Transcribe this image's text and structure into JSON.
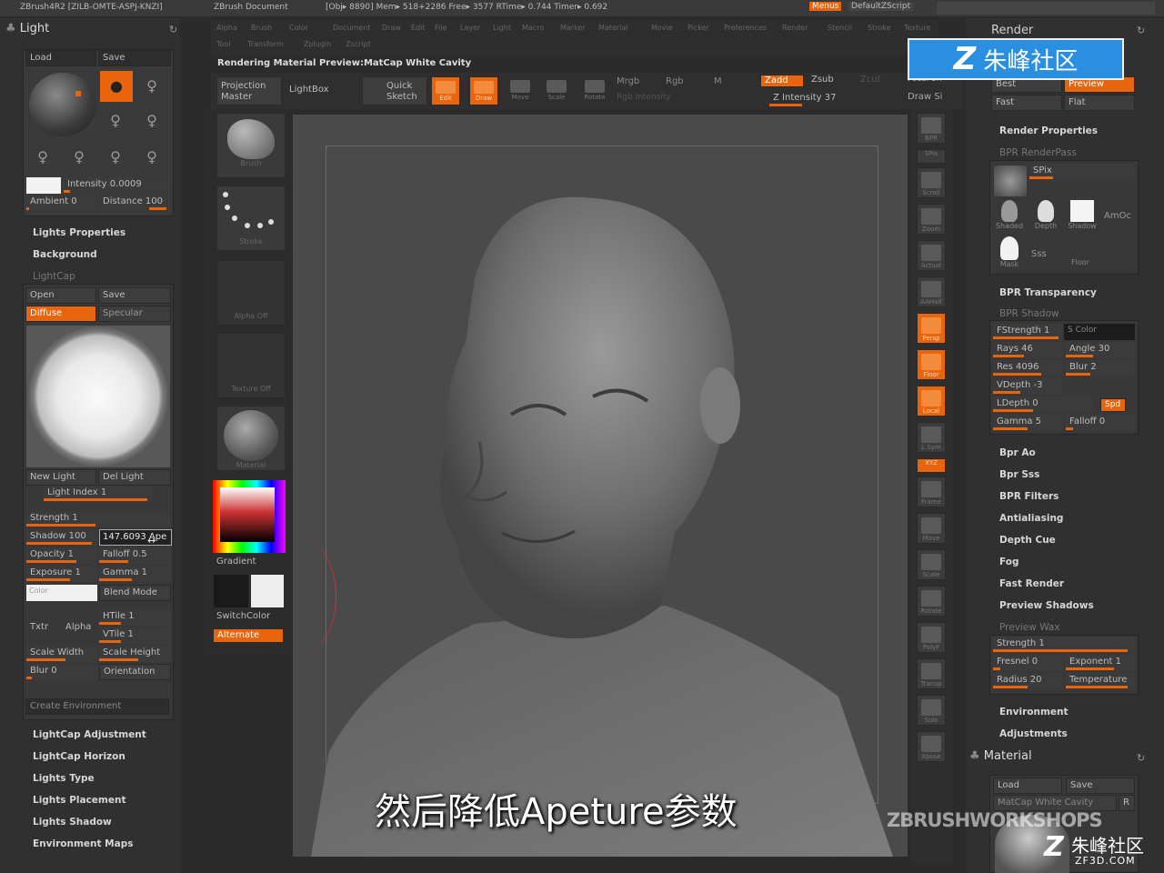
{
  "titlebar": {
    "app": "ZBrush4R2 [ZILB-OMTE-ASPJ-KNZI]",
    "doc": "ZBrush Document",
    "stats": "[Obj▸ 8890] Mem▸ 518+2286 Free▸ 3577 RTime▸ 0.744 Timer▸ 0.692",
    "menus_btn": "Menus",
    "script_btn": "DefaultZScript"
  },
  "menubar": {
    "row1": [
      "Alpha",
      "Brush",
      "Color",
      "Document",
      "Draw",
      "Edit",
      "File",
      "Layer",
      "Light",
      "Macro",
      "Marker",
      "Material",
      "Movie",
      "Picker",
      "Preferences",
      "Render",
      "Stencil",
      "Stroke",
      "Texture"
    ],
    "row2": [
      "Tool",
      "Transform",
      "Zplugin",
      "Zscript"
    ]
  },
  "status_text": "Rendering Material Preview:MatCap White Cavity",
  "light_panel": {
    "title": "Light",
    "load": "Load",
    "save": "Save",
    "intensity": "Intensity 0.0009",
    "ambient": "Ambient 0",
    "distance": "Distance 100",
    "lights_properties": "Lights Properties",
    "background": "Background",
    "lightcap": "LightCap",
    "open": "Open",
    "save2": "Save",
    "diffuse": "Diffuse",
    "specular": "Specular",
    "new_light": "New Light",
    "del_light": "Del Light",
    "light_index": "Light Index 1",
    "strength": "Strength 1",
    "shadow": "Shadow 100",
    "aperture_value": "147.6093",
    "aperture_suffix": "Ape",
    "opacity": "Opacity 1",
    "falloff": "Falloff 0.5",
    "exposure": "Exposure 1",
    "gamma": "Gamma 1",
    "color": "Color",
    "blend_mode": "Blend Mode",
    "txtr": "Txtr",
    "alpha": "Alpha",
    "htile": "HTile 1",
    "vtile": "VTile 1",
    "scale_width": "Scale Width",
    "scale_height": "Scale Height",
    "blur": "Blur 0",
    "orientation": "Orientation",
    "create_env": "Create Environment",
    "sections": [
      "LightCap Adjustment",
      "LightCap Horizon",
      "Lights Type",
      "Lights Placement",
      "Lights Shadow",
      "Environment Maps"
    ]
  },
  "left_shelf": {
    "thumbs": [
      "Brush",
      "Stroke",
      "Alpha Off",
      "Texture Off",
      "Material"
    ],
    "gradient": "Gradient",
    "switchcolor": "SwitchColor",
    "alternate": "Alternate"
  },
  "top_shelf": {
    "projection_master": "Projection Master",
    "lightbox": "LightBox",
    "quick_sketch": "Quick Sketch",
    "edit": "Edit",
    "draw": "Draw",
    "move": "Move",
    "scale": "Scale",
    "rotate": "Rotate",
    "mrgb": "Mrgb",
    "rgb": "Rgb",
    "m": "M",
    "rgb_intensity": "Rgb Intensity",
    "zadd": "Zadd",
    "zsub": "Zsub",
    "zcut": "Zcut",
    "z_intensity": "Z Intensity 37",
    "focal_shift": "Focal Sh",
    "draw_size": "Draw Si"
  },
  "right_tools": [
    "BPR",
    "SPix",
    "Scroll",
    "Zoom",
    "Actual",
    "AAHalf",
    "Persp",
    "Floor",
    "Local",
    "L.Sym",
    "XYZ",
    "Frame",
    "Move",
    "Scale",
    "Rotate",
    "PolyF",
    "Transp",
    "Solo",
    "Xpose"
  ],
  "render_panel": {
    "title": "Render",
    "best": "Best",
    "preview": "Preview",
    "fast": "Fast",
    "flat": "Flat",
    "render_properties": "Render Properties",
    "bpr_renderpass": "BPR RenderPass",
    "spix": "SPix",
    "shaded": "Shaded",
    "depth": "Depth",
    "shadow": "Shadow",
    "amboc": "AmOc",
    "mask": "Mask",
    "sss": "Sss",
    "floor": "Floor",
    "bpr_transparency": "BPR Transparency",
    "bpr_shadow": "BPR Shadow",
    "fstrength": "FStrength 1",
    "s_color": "S Color",
    "rays": "Rays 46",
    "angle": "Angle 30",
    "res": "Res 4096",
    "blur": "Blur 2",
    "vdepth": "VDepth -3",
    "ldepth": "LDepth 0",
    "spd": "Spd",
    "gamma": "Gamma 5",
    "falloff": "Falloff 0",
    "items": [
      "Bpr Ao",
      "Bpr Sss",
      "BPR Filters",
      "Antialiasing",
      "Depth Cue",
      "Fog",
      "Fast Render",
      "Preview Shadows"
    ],
    "preview_wax": "Preview Wax",
    "wax_strength": "Strength 1",
    "fresnel": "Fresnel 0",
    "exponent": "Exponent 1",
    "radius": "Radius 20",
    "temperature": "Temperature",
    "environment": "Environment",
    "adjustments": "Adjustments"
  },
  "material_panel": {
    "title": "Material",
    "load": "Load",
    "save": "Save",
    "current": "MatCap White Cavity",
    "r": "R"
  },
  "overlays": {
    "brand_top": "朱峰社区",
    "subtitle": "然后降低Apeture参数",
    "workshops": "ZBRUSHWORKSHOPS",
    "brand_bottom": "朱峰社区",
    "brand_url": "ZF3D.COM"
  },
  "colors": {
    "accent": "#e8650e",
    "brand_blue": "#2a8fe0"
  }
}
